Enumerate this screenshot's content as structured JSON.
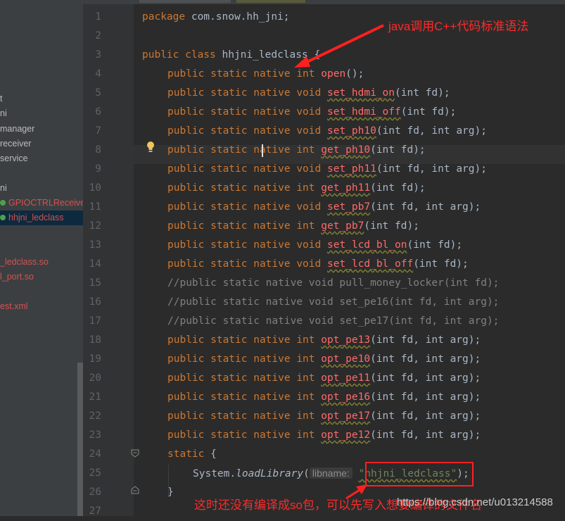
{
  "sidebar": {
    "items": [
      {
        "label": "t",
        "color": "normal"
      },
      {
        "label": "ni",
        "color": "normal"
      },
      {
        "label": "manager",
        "color": "normal"
      },
      {
        "label": "receiver",
        "color": "normal"
      },
      {
        "label": "service",
        "color": "normal"
      },
      {
        "label": "ni",
        "color": "normal"
      },
      {
        "label": "GPIOCTRLReceive",
        "color": "red",
        "icon": "class-icon"
      },
      {
        "label": "hhjni_ledclass",
        "color": "red",
        "icon": "class-icon",
        "selected": true
      },
      {
        "label": "_ledclass.so",
        "color": "red"
      },
      {
        "label": "l_port.so",
        "color": "red"
      },
      {
        "label": "est.xml",
        "color": "red"
      }
    ]
  },
  "editor": {
    "line_numbers": [
      "1",
      "2",
      "3",
      "4",
      "5",
      "6",
      "7",
      "8",
      "9",
      "10",
      "11",
      "12",
      "13",
      "14",
      "15",
      "16",
      "17",
      "18",
      "19",
      "20",
      "21",
      "22",
      "23",
      "24",
      "25",
      "26",
      "27"
    ],
    "code": {
      "l1_kw": "package",
      "l1_rest": " com.snow.hh_jni;",
      "l3_kw": "public class",
      "l3_rest": " hhjni_ledclass {",
      "l4_kw": "public static native int",
      "l4_fn": "open",
      "l4_rest": "();",
      "l5_kw": "public static native void",
      "l5_fn": "set_hdmi_on",
      "l5_a": "(int fd);",
      "l6_kw": "public static native void",
      "l6_fn": "set_hdmi_off",
      "l6_a": "(int fd);",
      "l7_kw": "public static native void",
      "l7_fn": "set_ph10",
      "l7_a": "(int fd, int arg);",
      "l8_kw": "public static native int",
      "l8_fn": "get_ph10",
      "l8_a": "(int fd);",
      "l9_kw": "public static native void",
      "l9_fn": "set_ph11",
      "l9_a": "(int fd, int arg);",
      "l10_kw": "public static native int",
      "l10_fn": "get_ph11",
      "l10_a": "(int fd);",
      "l11_kw": "public static native void",
      "l11_fn": "set_pb7",
      "l11_a": "(int fd, int arg);",
      "l12_kw": "public static native int",
      "l12_fn": "get_pb7",
      "l12_a": "(int fd);",
      "l13_kw": "public static native void",
      "l13_fn": "set_lcd_bl_on",
      "l13_a": "(int fd);",
      "l14_kw": "public static native void",
      "l14_fn": "set_lcd_bl_off",
      "l14_a": "(int fd);",
      "l15": "//public static native void pull_money_locker(int fd);",
      "l16": "//public static native void set_pe16(int fd, int arg);",
      "l17": "//public static native void set_pe17(int fd, int arg);",
      "l18_kw": "public static native int",
      "l18_fn": "opt_pe13",
      "l18_a": "(int fd, int arg);",
      "l19_kw": "public static native int",
      "l19_fn": "opt_pe10",
      "l19_a": "(int fd, int arg);",
      "l20_kw": "public static native int",
      "l20_fn": "opt_pe11",
      "l20_a": "(int fd, int arg);",
      "l21_kw": "public static native int",
      "l21_fn": "opt_pe16",
      "l21_a": "(int fd, int arg);",
      "l22_kw": "public static native int",
      "l22_fn": "opt_pe17",
      "l22_a": "(int fd, int arg);",
      "l23_kw": "public static native int",
      "l23_fn": "opt_pe12",
      "l23_a": "(int fd, int arg);",
      "l24_kw": "static",
      "l24_rest": " {",
      "l25_cls": "System.",
      "l25_m": "loadLibrary",
      "l25_p": "(",
      "l25_hint": "libname:",
      "l25_str": "\"hhjni_ledclass\"",
      "l25_end": ");",
      "l26": "}"
    }
  },
  "annotations": {
    "top": "java调用C++代码标准语法",
    "bottom": "这时还没有编译成so包，可以先写入想要编译的文件名"
  },
  "watermark": "https://blog.csdn.net/u013214588",
  "colors": {
    "annotation": "#ff2a2a",
    "keyword": "#cc7832",
    "method": "#ff6b68",
    "string": "#6a8759"
  }
}
